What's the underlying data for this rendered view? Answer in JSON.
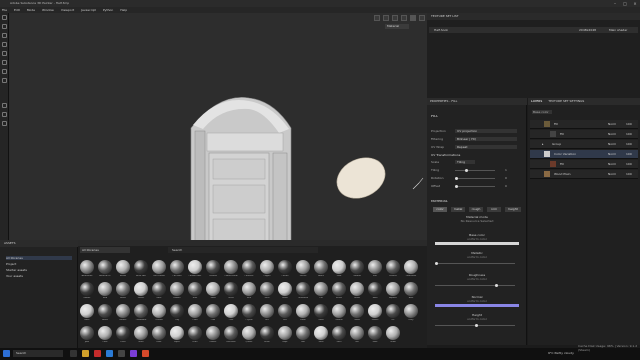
{
  "app": {
    "title": "Adobe Substance 3D Painter - Half.3mp"
  },
  "menu": [
    "File",
    "Edit",
    "Mode",
    "Window",
    "Viewport",
    "Javascript",
    "Python",
    "Help"
  ],
  "viewport": {
    "camera_select": "Material"
  },
  "texture_set_list": {
    "title": "TEXTURE SET LIST",
    "set_name": "Half.hook",
    "size": "2048x2048",
    "shader": "Main shader"
  },
  "properties": {
    "title": "PROPERTIES - FILL",
    "fill_label": "FILL",
    "projection_label": "Projection",
    "projection_value": "UV projection",
    "filtering_label": "Filtering",
    "filtering_value": "Bilinear | HQ",
    "uv_wrap_label": "UV Wrap",
    "uv_wrap_value": "Repeat",
    "uv_transform_label": "UV Transformations",
    "scale_label": "Scale",
    "scale_value": "Tiling",
    "tiling_label": "Tiling",
    "tiling_value": "1",
    "rotation_label": "Rotation",
    "rotation_value": "0",
    "offset_label": "Offset",
    "offset_value": "0",
    "material_label": "MATERIAL",
    "channels": [
      "color",
      "metal",
      "rough",
      "nrm",
      "height"
    ],
    "material_mode": "Material mode",
    "material_mode_value": "No Resource Selected",
    "base_color": "Base color",
    "base_color_sub": "uniform color",
    "base_color_hex": "#d6d6d6",
    "metallic": "Metallic",
    "metallic_sub": "uniform color",
    "roughness": "Roughness",
    "roughness_sub": "uniform color",
    "normal": "Normal",
    "normal_sub": "uniform color",
    "normal_hex": "#8a86e6",
    "height": "Height",
    "height_sub": "uniform color"
  },
  "layers": {
    "tabs": [
      "LAYERS",
      "TEXTURE SET SETTINGS"
    ],
    "mode": "Base color",
    "items": [
      {
        "name": "Fill",
        "blend": "Norm",
        "opacity": "100"
      },
      {
        "name": "Fill",
        "blend": "Norm",
        "opacity": "100"
      },
      {
        "name": "Group",
        "blend": "Norm",
        "opacity": "100"
      },
      {
        "name": "Color Variation",
        "blend": "Norm",
        "opacity": "100"
      },
      {
        "name": "Fill",
        "blend": "Norm",
        "opacity": "100"
      },
      {
        "name": "Wood Plain",
        "blend": "Norm",
        "opacity": "100"
      }
    ]
  },
  "assets": {
    "title": "ASSETS",
    "tree": [
      "All libraries",
      "Project",
      "Starter assets",
      "Your assets"
    ]
  },
  "shelf": {
    "tab": "All libraries",
    "search_placeholder": "Search",
    "materials": [
      "Aluminium",
      "Artificial Le",
      "Bread",
      "Brick Pale",
      "Calf Leather",
      "Car Paint",
      "Carbon Fiber",
      "Ceramic",
      "Coated Metal",
      "Concrete",
      "Copper",
      "Cotton",
      "Denim",
      "Fabric",
      "Gold",
      "Ground",
      "Iron",
      "Leather",
      "Limestone",
      "Marble",
      "Mud",
      "Nickel",
      "Plastic",
      "Rock",
      "Rubber",
      "Rust",
      "Sand",
      "Silver",
      "Skin",
      "Steel",
      "Stone",
      "Terracotta",
      "Tire",
      "Velvet",
      "Wood",
      "Wool",
      "Asphalt",
      "Bark",
      "Bone",
      "Brass",
      "Bronze",
      "Cardboard",
      "Chrome",
      "Clay",
      "Cloth",
      "Coal",
      "Cork",
      "Crystal",
      "Dirt",
      "Felt",
      "Foam",
      "Glass",
      "Granite",
      "Grass",
      "Gravel",
      "Ice",
      "Ivory",
      "Jade",
      "Lava",
      "Linen",
      "Moss",
      "Paint",
      "Paper",
      "Pearl",
      "Plaster",
      "Porcelain",
      "Quartz",
      "Resin",
      "Rope",
      "Salt",
      "Satin",
      "Shell",
      "Silk",
      "Slate",
      "Snow"
    ]
  },
  "statusbar": {
    "text": "Cache Disk Usage: 96% | Version: 9.1.2 (Steam)"
  },
  "taskbar": {
    "search": "Search",
    "weather": "9°C Partly cloudy"
  }
}
